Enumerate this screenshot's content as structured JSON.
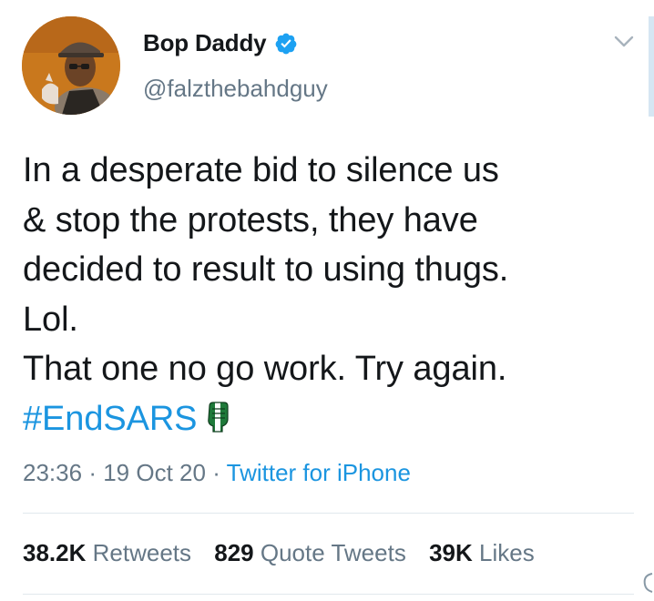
{
  "tweet": {
    "display_name": "Bop Daddy",
    "handle": "@falzthebahdguy",
    "text_lines": [
      "In a desperate bid to silence us",
      "& stop the protests, they have",
      "decided to result to using thugs.",
      "Lol.",
      "That one no go work. Try again."
    ],
    "hashtag": "#EndSARS",
    "time": "23:36",
    "date": "19 Oct 20",
    "source": "Twitter for iPhone",
    "separator": "·"
  },
  "stats": {
    "retweets_count": "38.2K",
    "retweets_label": "Retweets",
    "quote_count": "829",
    "quote_label": "Quote Tweets",
    "likes_count": "39K",
    "likes_label": "Likes"
  },
  "icons": {
    "verified": "verified-badge-icon",
    "caret": "chevron-down-icon",
    "emoji": "raised-fist-nigeria-flag-icon"
  },
  "colors": {
    "text": "#14171a",
    "secondary": "#657786",
    "link": "#1b95e0",
    "verified": "#1da1f2",
    "divider": "#e1e8ed"
  }
}
